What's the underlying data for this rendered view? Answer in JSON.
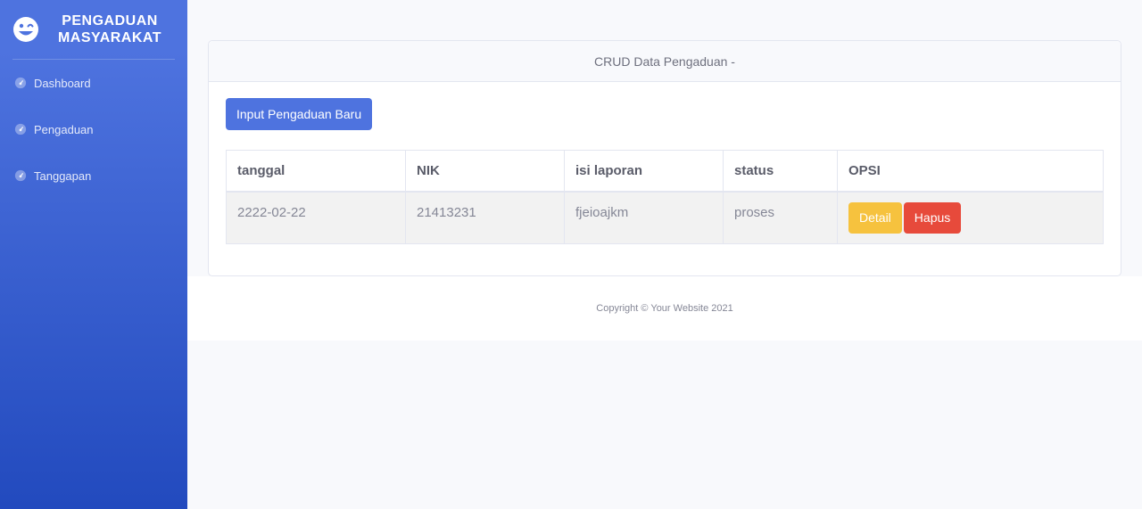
{
  "sidebar": {
    "brand_line1": "PENGADUAN",
    "brand_line2": "MASYARAKAT",
    "items": [
      {
        "label": "Dashboard",
        "icon": "tachometer-icon"
      },
      {
        "label": "Pengaduan",
        "icon": "tachometer-icon"
      },
      {
        "label": "Tanggapan",
        "icon": "tachometer-icon"
      }
    ]
  },
  "card": {
    "header": "CRUD Data Pengaduan -",
    "new_button": "Input Pengaduan Baru"
  },
  "table": {
    "columns": [
      "tanggal",
      "NIK",
      "isi laporan",
      "status",
      "OPSI"
    ],
    "rows": [
      {
        "tanggal": "2222-02-22",
        "nik": "21413231",
        "isi_laporan": "fjeioajkm",
        "status": "proses",
        "detail_label": "Detail",
        "hapus_label": "Hapus"
      }
    ]
  },
  "footer": {
    "text": "Copyright © Your Website 2021"
  },
  "colors": {
    "primary": "#4e73df",
    "primary_dark": "#224abe",
    "warning": "#f6c23e",
    "danger": "#e74a3b"
  }
}
